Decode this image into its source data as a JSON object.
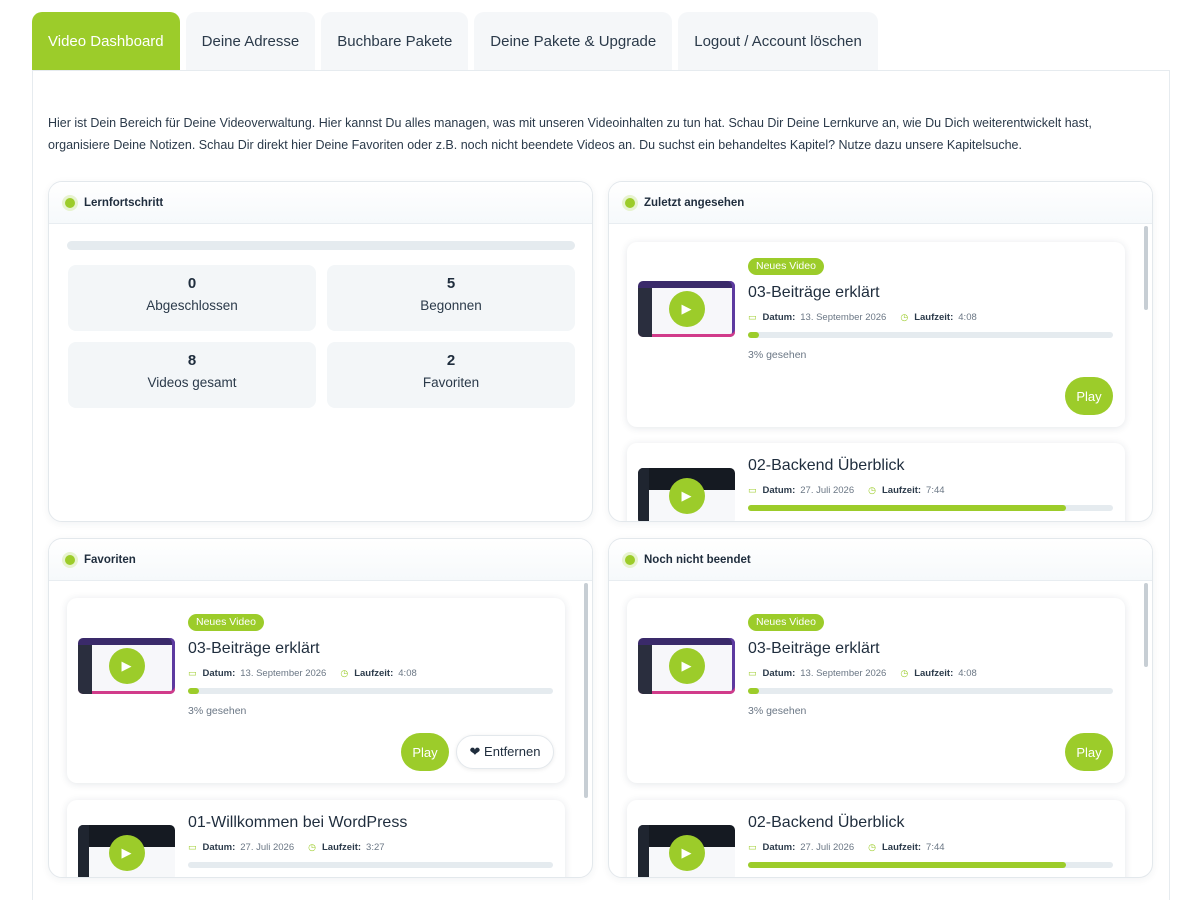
{
  "tabs": [
    {
      "label": "Video Dashboard"
    },
    {
      "label": "Deine Adresse"
    },
    {
      "label": "Buchbare Pakete"
    },
    {
      "label": "Deine Pakete & Upgrade"
    },
    {
      "label": "Logout / Account löschen"
    }
  ],
  "intro": "Hier ist Dein Bereich für Deine Videoverwaltung. Hier kannst Du alles managen, was mit unseren Videoinhalten zu tun hat. Schau Dir Deine Lernkurve an, wie Du Dich weiterentwickelt hast, organisiere Deine Notizen. Schau Dir direkt hier Deine Favoriten oder z.B. noch nicht beendete Videos an. Du suchst ein behandeltes Kapitel? Nutze dazu unsere Kapitelsuche.",
  "progress": {
    "title": "Lernfortschritt",
    "overall": 0,
    "stats": [
      {
        "value": "0",
        "label": "Abgeschlossen"
      },
      {
        "value": "5",
        "label": "Begonnen"
      },
      {
        "value": "8",
        "label": "Videos gesamt"
      },
      {
        "value": "2",
        "label": "Favoriten"
      }
    ]
  },
  "labels": {
    "date": "Datum:",
    "duration": "Laufzeit:",
    "play": "Play",
    "remove": "❤ Entfernen",
    "new_badge": "Neues Video"
  },
  "recent": {
    "title": "Zuletzt angesehen",
    "videos": [
      {
        "title": "03-Beiträge erklärt",
        "date": "13. September 2026",
        "duration": "4:08",
        "progress": 0.03,
        "seen": "3% gesehen"
      },
      {
        "title": "02-Backend Überblick",
        "date": "27. Juli 2026",
        "duration": "7:44",
        "progress": 0.87
      }
    ]
  },
  "favorites": {
    "title": "Favoriten",
    "videos": [
      {
        "title": "03-Beiträge erklärt",
        "date": "13. September 2026",
        "duration": "4:08",
        "progress": 0.03,
        "seen": "3% gesehen"
      },
      {
        "title": "01-Willkommen bei WordPress",
        "date": "27. Juli 2026",
        "duration": "3:27",
        "progress": 0
      }
    ]
  },
  "unfinished": {
    "title": "Noch nicht beendet",
    "videos": [
      {
        "title": "03-Beiträge erklärt",
        "date": "13. September 2026",
        "duration": "4:08",
        "progress": 0.03,
        "seen": "3% gesehen"
      },
      {
        "title": "02-Backend Überblick",
        "date": "27. Juli 2026",
        "duration": "7:44",
        "progress": 0.87
      }
    ]
  },
  "colors": {
    "accent": "#9ccc2a"
  }
}
